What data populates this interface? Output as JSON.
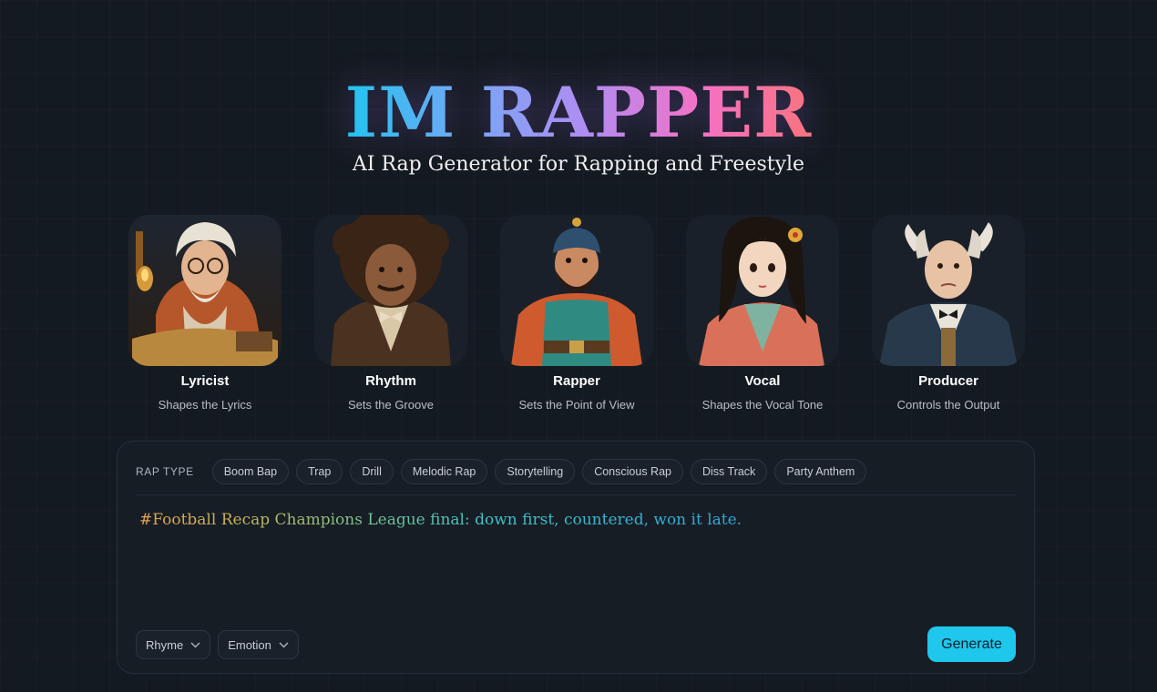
{
  "header": {
    "brand": "IM RAPPER",
    "tagline": "AI Rap Generator for Rapping and Freestyle"
  },
  "roles": [
    {
      "name": "Lyricist",
      "desc": "Shapes the Lyrics"
    },
    {
      "name": "Rhythm",
      "desc": "Sets the Groove"
    },
    {
      "name": "Rapper",
      "desc": "Sets the Point of View"
    },
    {
      "name": "Vocal",
      "desc": "Shapes the Vocal Tone"
    },
    {
      "name": "Producer",
      "desc": "Controls the Output"
    }
  ],
  "composer": {
    "rap_type_label": "RAP TYPE",
    "rap_types": [
      "Boom Bap",
      "Trap",
      "Drill",
      "Melodic Rap",
      "Storytelling",
      "Conscious Rap",
      "Diss Track",
      "Party Anthem"
    ],
    "prompt": "#Football Recap Champions League final: down first, countered, won it late.",
    "selects": [
      {
        "label": "Rhyme",
        "icon": "chevron-down-icon"
      },
      {
        "label": "Emotion",
        "icon": "chevron-down-icon"
      }
    ],
    "generate_label": "Generate"
  },
  "colors": {
    "background": "#141a21",
    "panel": "#161d25",
    "accent": "#1fc7ec",
    "brand_gradient": [
      "#22c3f0",
      "#b18cf2",
      "#f472c6",
      "#f9737e"
    ]
  }
}
